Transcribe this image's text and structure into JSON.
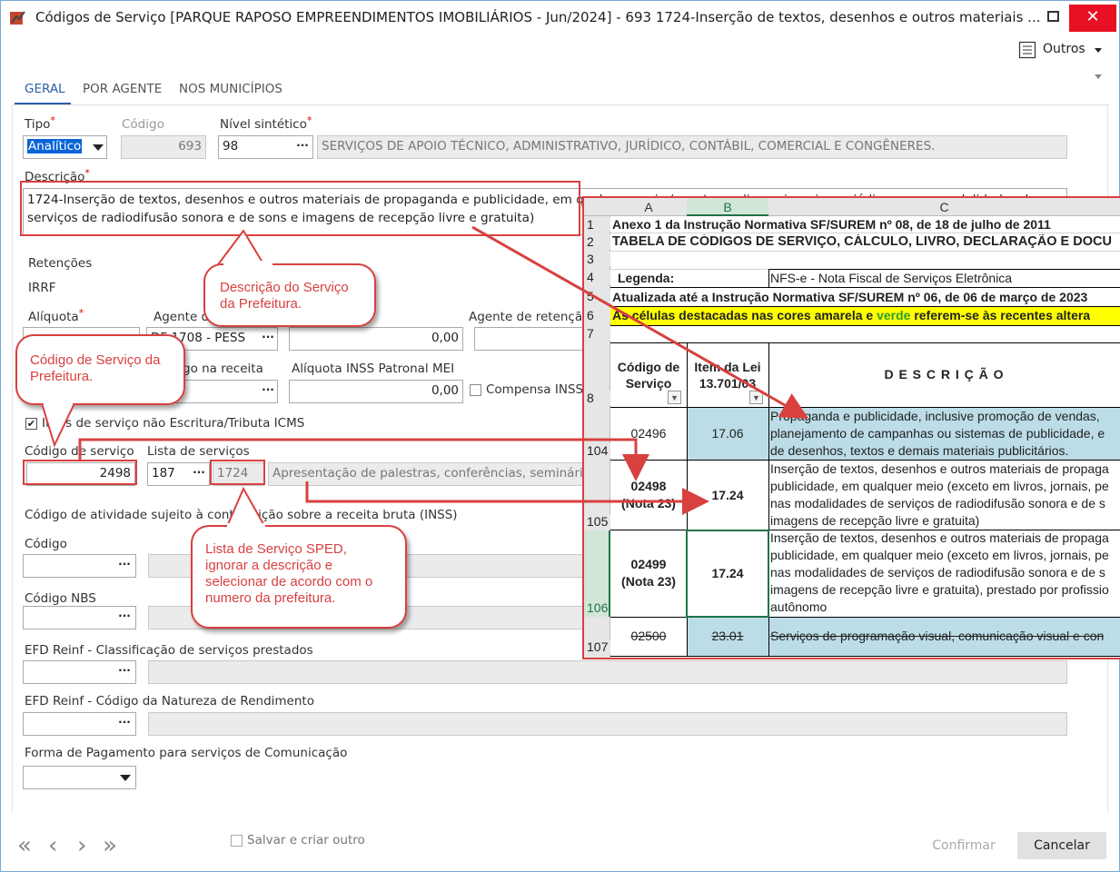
{
  "window": {
    "title": "Códigos de Serviço [PARQUE RAPOSO EMPREENDIMENTOS IMOBILIÁRIOS - Jun/2024]  - 693 1724-Inserção de textos, desenhos e outros materiais ...",
    "outros_label": "Outros"
  },
  "tabs": [
    "GERAL",
    "POR AGENTE",
    "NOS MUNICÍPIOS"
  ],
  "form": {
    "tipo_label": "Tipo",
    "tipo_value": "Analítico",
    "codigo_label": "Código",
    "codigo_value": "693",
    "nivel_label": "Nível sintético",
    "nivel_value": "98",
    "nivel_desc": "SERVIÇOS DE APOIO TÉCNICO, ADMINISTRATIVO, JURÍDICO, CONTÁBIL, COMERCIAL E CONGÊNERES.",
    "descricao_label": "Descrição",
    "descricao_value": "1724-Inserção de textos, desenhos e outros materiais de propaganda e publicidade, em qualquer meio (exceto em livros, jornais, periódicos e nas modalidades de serviços de radiodifusão sonora e de sons e imagens de recepção livre e gratuita)",
    "retencoes_label": "Retenções",
    "irrf_label": "IRRF",
    "aliquota_label": "Alíquota",
    "agente_label": "Agente d",
    "agente_value": "DF 1708 - PESS",
    "agente_num": "0,00",
    "agente_retencao_label": "Agente de retenção",
    "codigo_receita_label": "go na receita",
    "aliquota_inss_label": "Alíquota INSS Patronal MEI",
    "aliquota_inss_value": "0,00",
    "compensa_label": "Compensa INSS",
    "itens_check_label": "Itens de serviço não Escritura/Tributa ICMS",
    "codigo_servico_label": "Código de serviço",
    "codigo_servico_value": "2498",
    "lista_label": "Lista de serviços",
    "lista_value": "187",
    "lista_code": "1724",
    "lista_desc": "Apresentação de palestras, conferências, seminários",
    "atividade_label": "Código de atividade sujeito à contribuição sobre a receita bruta (INSS)",
    "codigo2_label": "Código",
    "nbs_label": "Código NBS",
    "reinf_class_label": "EFD Reinf - Classificação de serviços prestados",
    "reinf_nat_label": "EFD Reinf - Código da Natureza de Rendimento",
    "forma_pag_label": "Forma de Pagamento para serviços de Comunicação"
  },
  "footer": {
    "salvar_label": "Salvar e criar outro",
    "confirmar_label": "Confirmar",
    "cancelar_label": "Cancelar"
  },
  "callouts": {
    "descricao": "Descrição do Serviço da Prefeitura.",
    "codigo": "Código de Serviço da Prefeitura.",
    "lista": "Lista de Serviço SPED, ignorar a descrição e selecionar de acordo com o numero da prefeitura."
  },
  "sheet": {
    "cols": [
      "A",
      "B",
      "C"
    ],
    "r1": "Anexo 1 da Instrução Normativa SF/SUREM nº 08, de 18 de julho de 2011",
    "r2": "TABELA DE CÓDIGOS DE SERVIÇO, CÁLCULO, LIVRO, DECLARAÇÃO E DOCU",
    "r4a": "Legenda:",
    "r4c": "NFS-e - Nota Fiscal de Serviços Eletrônica",
    "r5": "Atualizada até a Instrução Normativa SF/SUREM nº 06, de 06 de março de 2023",
    "r6a": "As células destacadas nas cores amarela e ",
    "r6b": "verde",
    "r6c": " referem-se às recentes altera",
    "h_a": "Código de Serviço",
    "h_b": "Item da Lei 13.701/03",
    "h_c": "D E S C R I Ç Ã O",
    "row104": {
      "a": "02496",
      "b": "17.06",
      "c1": "Propaganda e publicidade, inclusive promoção de vendas,",
      "c2": "planejamento de campanhas ou sistemas de publicidade, e",
      "c3": "de desenhos, textos e demais materiais publicitários."
    },
    "row105": {
      "a1": "02498",
      "a2": "(Nota 23)",
      "b": "17.24",
      "c1": "Inserção de textos, desenhos e outros materiais de propaga",
      "c2": "publicidade, em qualquer meio (exceto em livros, jornais, pe",
      "c3": "nas modalidades de serviços de radiodifusão sonora e de s",
      "c4": "imagens de recepção livre e gratuita)"
    },
    "row106": {
      "a1": "02499",
      "a2": "(Nota 23)",
      "b": "17.24",
      "c1": "Inserção de textos, desenhos e outros materiais de propaga",
      "c2": "publicidade, em qualquer meio (exceto em livros, jornais, pe",
      "c3": "nas modalidades de serviços de radiodifusão sonora e de s",
      "c4": "imagens de recepção livre e gratuita), prestado por profissio",
      "c5": "autônomo"
    },
    "row107": {
      "a": "02500",
      "b": "23.01",
      "c": "Serviços de programação visual, comunicação visual e con"
    },
    "rownums": [
      "1",
      "2",
      "3",
      "4",
      "5",
      "6",
      "7",
      "8",
      "104",
      "105",
      "106",
      "107"
    ]
  }
}
